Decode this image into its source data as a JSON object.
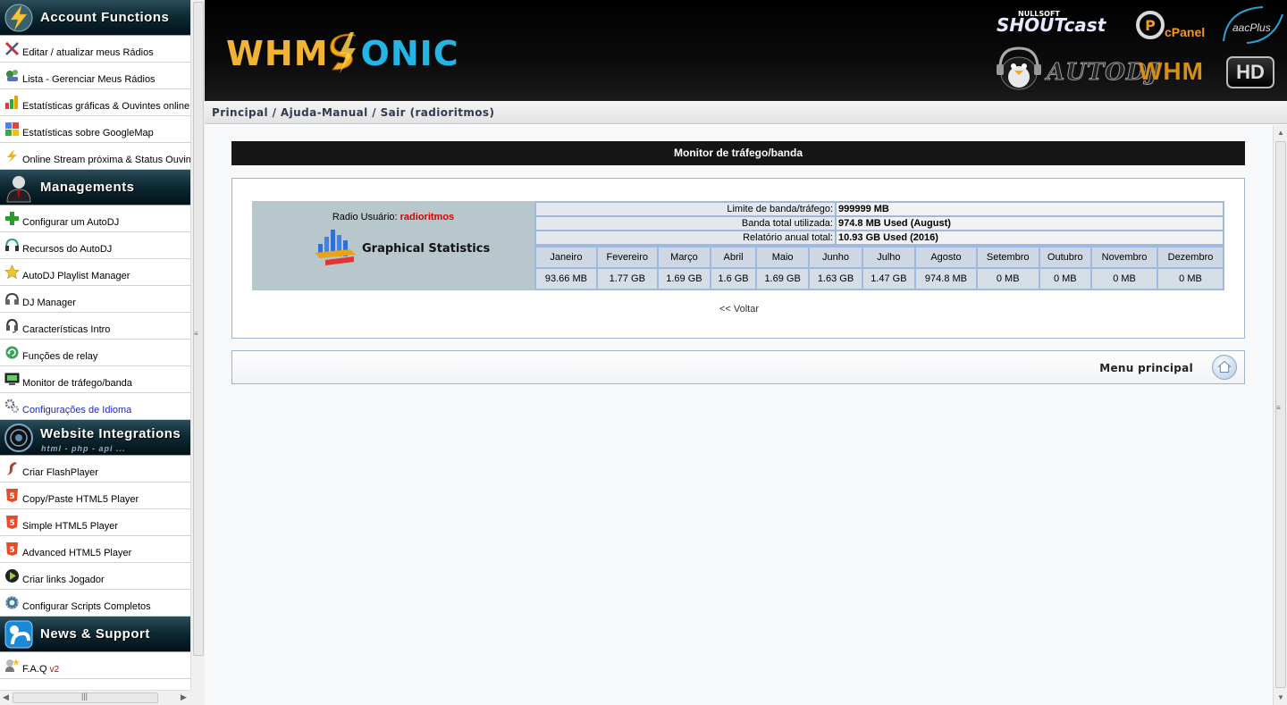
{
  "sidebar": {
    "sections": [
      {
        "title": "Account Functions",
        "icon": "lightning-icon",
        "items": [
          {
            "label": "Editar / atualizar meus Rádios",
            "icon": "tools-icon"
          },
          {
            "label": "Lista - Gerenciar Meus Rádios",
            "icon": "list-icon"
          },
          {
            "label": "Estatísticas gráficas & Ouvintes online",
            "icon": "bar-chart-icon"
          },
          {
            "label": "Estatísticas sobre GoogleMap",
            "icon": "google-map-icon"
          },
          {
            "label": "Online Stream próxima & Status Ouvinte",
            "icon": "lightning-icon"
          }
        ]
      },
      {
        "title": "Managements",
        "icon": "user-manager-icon",
        "items": [
          {
            "label": "Configurar um AutoDJ",
            "icon": "plus-icon"
          },
          {
            "label": "Recursos do AutoDJ",
            "icon": "headphones-icon"
          },
          {
            "label": "AutoDJ Playlist Manager",
            "icon": "star-icon"
          },
          {
            "label": "DJ Manager",
            "icon": "dj-icon"
          },
          {
            "label": "Características Intro",
            "icon": "headset-icon"
          },
          {
            "label": "Funções de relay",
            "icon": "relay-icon"
          },
          {
            "label": "Monitor de tráfego/banda",
            "icon": "monitor-icon"
          },
          {
            "label": "Configurações de Idioma",
            "icon": "language-gears-icon"
          }
        ]
      },
      {
        "title": "Website Integrations",
        "subtitle": "html - php - api ...",
        "icon": "globe-icon",
        "items": [
          {
            "label": "Criar FlashPlayer",
            "icon": "flash-icon"
          },
          {
            "label": "Copy/Paste HTML5 Player",
            "icon": "html5-icon"
          },
          {
            "label": "Simple HTML5 Player",
            "icon": "html5-icon"
          },
          {
            "label": "Advanced HTML5 Player",
            "icon": "html5-icon"
          },
          {
            "label": "Criar links Jogador",
            "icon": "play-icon"
          },
          {
            "label": "Configurar Scripts Completos",
            "icon": "gears-icon"
          }
        ]
      },
      {
        "title": "News & Support",
        "icon": "support-icon",
        "items": [
          {
            "label": "F.A.Q",
            "badge": "v2",
            "icon": "faq-icon"
          }
        ]
      }
    ]
  },
  "header": {
    "logo_left": "WHM",
    "logo_right": "ONIC",
    "brands": {
      "shoutcast_small": "NULLSOFT",
      "shoutcast": "SHOUTcast",
      "cpanel": "cPanel",
      "aacplus": "aacPlus",
      "autodj": "AUTODJ",
      "whm": "WHM",
      "hd": "HD"
    }
  },
  "breadcrumb": {
    "text": "Principal / Ajuda-Manual / Sair (radioritmos)"
  },
  "main": {
    "title": "Monitor de tráfego/banda",
    "radio_user_label": "Radio Usuário:",
    "radio_user_name": "radioritmos",
    "graphical_statistics": "Graphical Statistics",
    "info": [
      {
        "label": "Limite de banda/tráfego:",
        "value": "999999 MB"
      },
      {
        "label": "Banda total utilizada:",
        "value": "974.8 MB Used (August)"
      },
      {
        "label": "Relatório anual total:",
        "value": "10.93 GB Used (2016)"
      }
    ],
    "months": [
      "Janeiro",
      "Fevereiro",
      "Março",
      "Abril",
      "Maio",
      "Junho",
      "Julho",
      "Agosto",
      "Setembro",
      "Outubro",
      "Novembro",
      "Dezembro"
    ],
    "usage": [
      "93.66 MB",
      "1.77 GB",
      "1.69 GB",
      "1.6 GB",
      "1.69 GB",
      "1.63 GB",
      "1.47 GB",
      "974.8 MB",
      "0 MB",
      "0 MB",
      "0 MB",
      "0 MB"
    ],
    "back_link": "<< Voltar",
    "menu_principal": "Menu principal"
  },
  "colors": {
    "header_bg": "#000000",
    "logo_orange": "#f2b233",
    "logo_blue": "#23b5e6",
    "title_bar": "#161616",
    "radio_name": "#d40000",
    "panel_border": "#9cb5cc",
    "table_bg": "#b7c7cc"
  }
}
